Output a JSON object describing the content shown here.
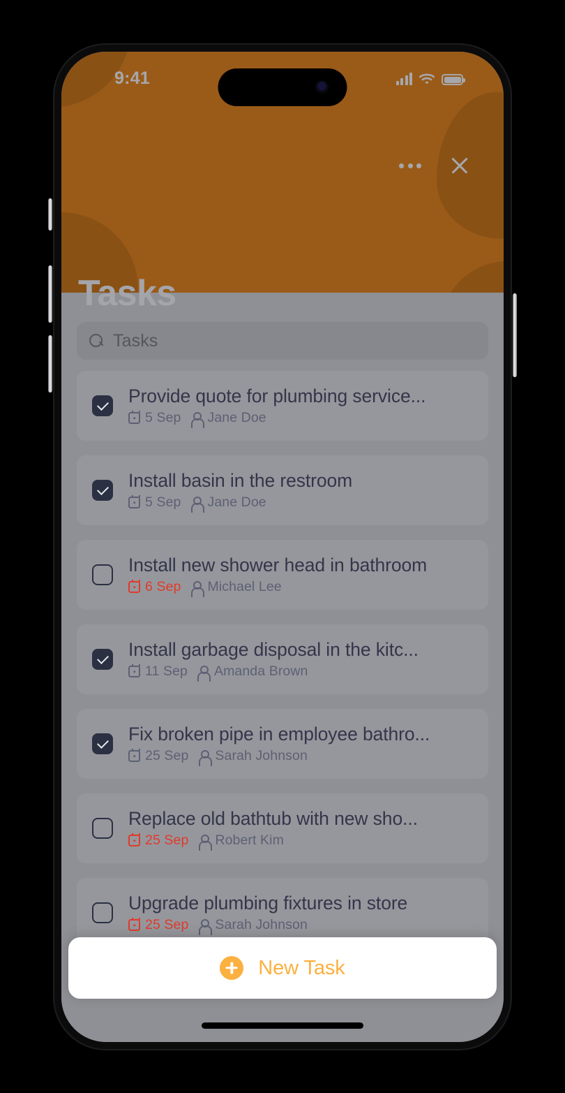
{
  "status_bar": {
    "time": "9:41",
    "signal_icon": "cellular-signal-icon",
    "wifi_icon": "wifi-icon",
    "battery_icon": "battery-icon"
  },
  "header": {
    "title": "Tasks",
    "accent_color": "#9a5b18",
    "title_color": "#a4a5aa",
    "more_icon": "more-options-icon",
    "close_icon": "close-icon"
  },
  "search": {
    "placeholder": "Tasks",
    "icon": "search-icon"
  },
  "tasks": [
    {
      "title": "Provide quote for plumbing service...",
      "date": "5 Sep",
      "assignee": "Jane Doe",
      "checked": true,
      "overdue": false
    },
    {
      "title": "Install basin in the restroom",
      "date": "5 Sep",
      "assignee": "Jane Doe",
      "checked": true,
      "overdue": false
    },
    {
      "title": "Install new shower head in bathroom",
      "date": "6 Sep",
      "assignee": "Michael Lee",
      "checked": false,
      "overdue": true
    },
    {
      "title": "Install garbage disposal in the kitc...",
      "date": "11 Sep",
      "assignee": "Amanda Brown",
      "checked": true,
      "overdue": false
    },
    {
      "title": "Fix broken pipe in employee bathro...",
      "date": "25 Sep",
      "assignee": "Sarah Johnson",
      "checked": true,
      "overdue": false
    },
    {
      "title": "Replace old bathtub with new sho...",
      "date": "25 Sep",
      "assignee": "Robert Kim",
      "checked": false,
      "overdue": true
    },
    {
      "title": "Upgrade plumbing fixtures in store",
      "date": "25 Sep",
      "assignee": "Sarah Johnson",
      "checked": false,
      "overdue": true
    }
  ],
  "footer": {
    "new_task_label": "New Task",
    "plus_icon": "plus-circle-icon",
    "accent_color": "#fbb040"
  },
  "theme": {
    "sheet_background": "#8f9095",
    "row_background": "#96979c",
    "checkbox_color": "#2b3043",
    "overdue_color": "#e03a2b",
    "meta_color": "#5c6074"
  }
}
